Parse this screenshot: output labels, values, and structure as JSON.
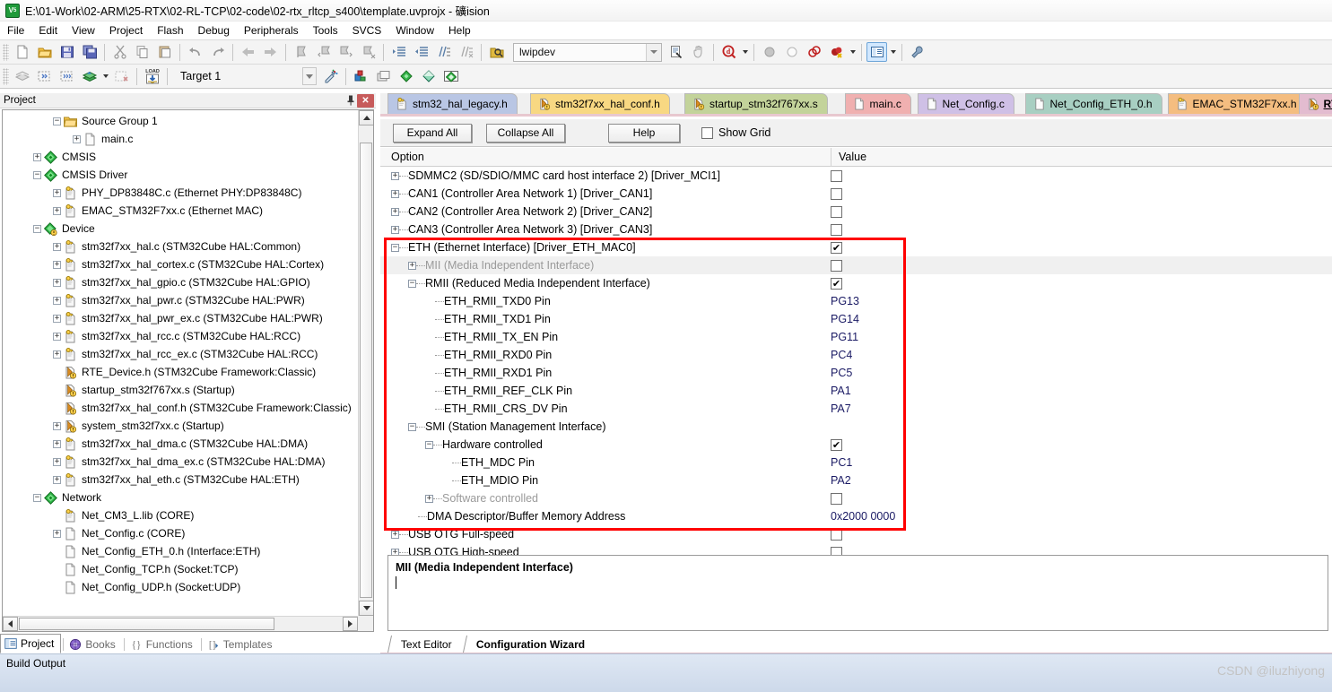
{
  "window": {
    "title": "E:\\01-Work\\02-ARM\\25-RTX\\02-RL-TCP\\02-code\\02-rtx_rltcp_s400\\template.uvprojx - 礦ision",
    "app_icon": "uvision-icon"
  },
  "menubar": {
    "items": [
      "File",
      "Edit",
      "View",
      "Project",
      "Flash",
      "Debug",
      "Peripherals",
      "Tools",
      "SVCS",
      "Window",
      "Help"
    ]
  },
  "toolbar2": {
    "target_value": "Target 1",
    "device_value": "lwipdev"
  },
  "project_panel": {
    "title": "Project",
    "pin_icon": "pin-icon",
    "close_icon": "close-icon",
    "tree": [
      {
        "indent": 1,
        "toggle": "minus",
        "icon": "folder-icon",
        "label": "Source Group 1"
      },
      {
        "indent": 2,
        "toggle": "plus",
        "icon": "file-icon",
        "label": "main.c"
      },
      {
        "indent": 0,
        "toggle": "plus",
        "icon": "diamond-green",
        "label": "CMSIS"
      },
      {
        "indent": 0,
        "toggle": "minus",
        "icon": "diamond-green",
        "label": "CMSIS Driver"
      },
      {
        "indent": 1,
        "toggle": "plus",
        "icon": "file-key-icon",
        "label": "PHY_DP83848C.c (Ethernet PHY:DP83848C)"
      },
      {
        "indent": 1,
        "toggle": "plus",
        "icon": "file-key-icon",
        "label": "EMAC_STM32F7xx.c (Ethernet MAC)"
      },
      {
        "indent": 0,
        "toggle": "minus",
        "icon": "diamond-warn",
        "label": "Device"
      },
      {
        "indent": 1,
        "toggle": "plus",
        "icon": "file-key-icon",
        "label": "stm32f7xx_hal.c (STM32Cube HAL:Common)"
      },
      {
        "indent": 1,
        "toggle": "plus",
        "icon": "file-key-icon",
        "label": "stm32f7xx_hal_cortex.c (STM32Cube HAL:Cortex)"
      },
      {
        "indent": 1,
        "toggle": "plus",
        "icon": "file-key-icon",
        "label": "stm32f7xx_hal_gpio.c (STM32Cube HAL:GPIO)"
      },
      {
        "indent": 1,
        "toggle": "plus",
        "icon": "file-key-icon",
        "label": "stm32f7xx_hal_pwr.c (STM32Cube HAL:PWR)"
      },
      {
        "indent": 1,
        "toggle": "plus",
        "icon": "file-key-icon",
        "label": "stm32f7xx_hal_pwr_ex.c (STM32Cube HAL:PWR)"
      },
      {
        "indent": 1,
        "toggle": "plus",
        "icon": "file-key-icon",
        "label": "stm32f7xx_hal_rcc.c (STM32Cube HAL:RCC)"
      },
      {
        "indent": 1,
        "toggle": "plus",
        "icon": "file-key-icon",
        "label": "stm32f7xx_hal_rcc_ex.c (STM32Cube HAL:RCC)"
      },
      {
        "indent": 1,
        "toggle": "none",
        "icon": "file-warn-icon",
        "label": "RTE_Device.h (STM32Cube Framework:Classic)"
      },
      {
        "indent": 1,
        "toggle": "none",
        "icon": "file-warn-icon",
        "label": "startup_stm32f767xx.s (Startup)"
      },
      {
        "indent": 1,
        "toggle": "none",
        "icon": "file-warn-icon",
        "label": "stm32f7xx_hal_conf.h (STM32Cube Framework:Classic)"
      },
      {
        "indent": 1,
        "toggle": "plus",
        "icon": "file-warn-icon",
        "label": "system_stm32f7xx.c (Startup)"
      },
      {
        "indent": 1,
        "toggle": "plus",
        "icon": "file-key-icon",
        "label": "stm32f7xx_hal_dma.c (STM32Cube HAL:DMA)"
      },
      {
        "indent": 1,
        "toggle": "plus",
        "icon": "file-key-icon",
        "label": "stm32f7xx_hal_dma_ex.c (STM32Cube HAL:DMA)"
      },
      {
        "indent": 1,
        "toggle": "plus",
        "icon": "file-key-icon",
        "label": "stm32f7xx_hal_eth.c (STM32Cube HAL:ETH)"
      },
      {
        "indent": 0,
        "toggle": "minus",
        "icon": "diamond-green",
        "label": "Network"
      },
      {
        "indent": 1,
        "toggle": "none",
        "icon": "file-key-icon",
        "label": "Net_CM3_L.lib (CORE)"
      },
      {
        "indent": 1,
        "toggle": "plus",
        "icon": "file-icon",
        "label": "Net_Config.c (CORE)"
      },
      {
        "indent": 1,
        "toggle": "none",
        "icon": "file-plain",
        "label": "Net_Config_ETH_0.h (Interface:ETH)"
      },
      {
        "indent": 1,
        "toggle": "none",
        "icon": "file-plain",
        "label": "Net_Config_TCP.h (Socket:TCP)"
      },
      {
        "indent": 1,
        "toggle": "none",
        "icon": "file-plain",
        "label": "Net_Config_UDP.h (Socket:UDP)"
      }
    ],
    "bottom_tabs": [
      {
        "label": "Project",
        "icon": "project-icon",
        "active": true
      },
      {
        "label": "Books",
        "icon": "books-icon",
        "active": false
      },
      {
        "label": "Functions",
        "icon": "functions-icon",
        "active": false
      },
      {
        "label": "Templates",
        "icon": "templates-icon",
        "active": false
      }
    ]
  },
  "editor": {
    "tabs": [
      {
        "label": "stm32_hal_legacy.h",
        "icon": "file-key-icon",
        "color": "#b9c6e4",
        "active": false
      },
      {
        "label": "stm32f7xx_hal_conf.h",
        "icon": "file-warn-icon",
        "color": "#f8d882",
        "active": false
      },
      {
        "label": "startup_stm32f767xx.s",
        "icon": "file-warn-icon",
        "color": "#c3d39a",
        "active": false
      },
      {
        "label": "main.c",
        "icon": "file-plain",
        "color": "#f0b0b0",
        "active": false
      },
      {
        "label": "Net_Config.c",
        "icon": "file-plain",
        "color": "#cfc0e6",
        "active": false
      },
      {
        "label": "Net_Config_ETH_0.h",
        "icon": "file-plain",
        "color": "#a8cfc2",
        "active": false
      },
      {
        "label": "EMAC_STM32F7xx.h",
        "icon": "file-key-icon",
        "color": "#f4bd80",
        "active": false
      },
      {
        "label": "RTE_Device.h",
        "icon": "file-warn-icon",
        "color": "#e3bcd0",
        "active": true
      }
    ],
    "wizard_toolbar": {
      "expand_all": "Expand All",
      "collapse_all": "Collapse All",
      "help": "Help",
      "show_grid_label": "Show Grid",
      "show_grid_checked": false
    },
    "columns": {
      "option": "Option",
      "value": "Value"
    },
    "rows": [
      {
        "indent": 0,
        "toggle": "plus",
        "label": "SDMMC2 (SD/SDIO/MMC card host interface 2) [Driver_MCI1]",
        "type": "checkbox",
        "checked": false,
        "dim": false,
        "highlight": false
      },
      {
        "indent": 0,
        "toggle": "plus",
        "label": "CAN1 (Controller Area Network 1) [Driver_CAN1]",
        "type": "checkbox",
        "checked": false,
        "dim": false,
        "highlight": false
      },
      {
        "indent": 0,
        "toggle": "plus",
        "label": "CAN2 (Controller Area Network 2) [Driver_CAN2]",
        "type": "checkbox",
        "checked": false,
        "dim": false,
        "highlight": false
      },
      {
        "indent": 0,
        "toggle": "plus",
        "label": "CAN3 (Controller Area Network 3) [Driver_CAN3]",
        "type": "checkbox",
        "checked": false,
        "dim": false,
        "highlight": false
      },
      {
        "indent": 0,
        "toggle": "minus",
        "label": "ETH (Ethernet Interface) [Driver_ETH_MAC0]",
        "type": "checkbox",
        "checked": true,
        "dim": false,
        "highlight": false
      },
      {
        "indent": 1,
        "toggle": "plus",
        "label": "MII (Media Independent Interface)",
        "type": "checkbox",
        "checked": false,
        "dim": true,
        "highlight": true
      },
      {
        "indent": 1,
        "toggle": "minus",
        "label": "RMII (Reduced Media Independent Interface)",
        "type": "checkbox",
        "checked": true,
        "dim": false,
        "highlight": false
      },
      {
        "indent": 2,
        "toggle": "none",
        "label": "ETH_RMII_TXD0 Pin",
        "type": "text",
        "value": "PG13",
        "dim": false,
        "highlight": false
      },
      {
        "indent": 2,
        "toggle": "none",
        "label": "ETH_RMII_TXD1 Pin",
        "type": "text",
        "value": "PG14",
        "dim": false,
        "highlight": false
      },
      {
        "indent": 2,
        "toggle": "none",
        "label": "ETH_RMII_TX_EN Pin",
        "type": "text",
        "value": "PG11",
        "dim": false,
        "highlight": false
      },
      {
        "indent": 2,
        "toggle": "none",
        "label": "ETH_RMII_RXD0 Pin",
        "type": "text",
        "value": "PC4",
        "dim": false,
        "highlight": false
      },
      {
        "indent": 2,
        "toggle": "none",
        "label": "ETH_RMII_RXD1 Pin",
        "type": "text",
        "value": "PC5",
        "dim": false,
        "highlight": false
      },
      {
        "indent": 2,
        "toggle": "none",
        "label": "ETH_RMII_REF_CLK Pin",
        "type": "text",
        "value": "PA1",
        "dim": false,
        "highlight": false
      },
      {
        "indent": 2,
        "toggle": "none",
        "label": "ETH_RMII_CRS_DV Pin",
        "type": "text",
        "value": "PA7",
        "dim": false,
        "highlight": false
      },
      {
        "indent": 1,
        "toggle": "minus",
        "label": "SMI (Station Management Interface)",
        "type": "none",
        "dim": false,
        "highlight": false
      },
      {
        "indent": 2,
        "toggle": "minus",
        "label": "Hardware controlled",
        "type": "checkbox",
        "checked": true,
        "dim": false,
        "highlight": false
      },
      {
        "indent": 3,
        "toggle": "none",
        "label": "ETH_MDC Pin",
        "type": "text",
        "value": "PC1",
        "dim": false,
        "highlight": false
      },
      {
        "indent": 3,
        "toggle": "none",
        "label": "ETH_MDIO Pin",
        "type": "text",
        "value": "PA2",
        "dim": false,
        "highlight": false
      },
      {
        "indent": 2,
        "toggle": "plus",
        "label": "Software controlled",
        "type": "checkbox",
        "checked": false,
        "dim": true,
        "highlight": false
      },
      {
        "indent": 1,
        "toggle": "none",
        "label": "DMA Descriptor/Buffer Memory Address",
        "type": "text",
        "value": "0x2000 0000",
        "dim": false,
        "highlight": false
      },
      {
        "indent": 0,
        "toggle": "plus",
        "label": "USB OTG Full-speed",
        "type": "checkbox",
        "checked": false,
        "dim": false,
        "highlight": false
      },
      {
        "indent": 0,
        "toggle": "plus",
        "label": "USB OTG High-speed",
        "type": "checkbox",
        "checked": false,
        "dim": false,
        "highlight": false
      }
    ],
    "description": {
      "title": "MII (Media Independent Interface)",
      "body": ""
    },
    "bottom_tabs": [
      {
        "label": "Text Editor",
        "active": false
      },
      {
        "label": "Configuration Wizard",
        "active": true
      }
    ],
    "highlight_color": "#ff0000"
  },
  "status": {
    "build_output_label": "Build Output",
    "watermark": "CSDN @iluzhiyong"
  }
}
